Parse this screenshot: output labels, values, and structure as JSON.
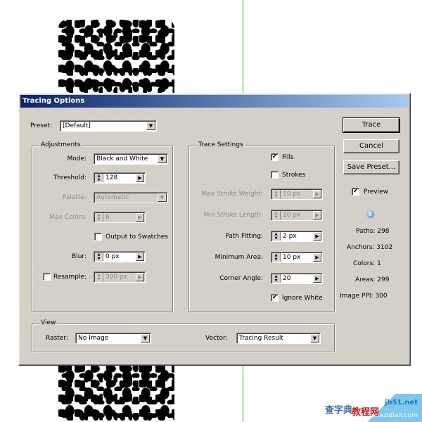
{
  "window": {
    "title": "Tracing Options"
  },
  "preset": {
    "label": "Preset:",
    "value": "[Default]"
  },
  "buttons": {
    "trace": "Trace",
    "cancel": "Cancel",
    "save_preset": "Save Preset..."
  },
  "preview": {
    "label": "Preview",
    "checked": true
  },
  "adjustments": {
    "title": "Adjustments",
    "mode_label": "Mode:",
    "mode_value": "Black and White",
    "threshold_label": "Threshold:",
    "threshold_value": "128",
    "palette_label": "Palette:",
    "palette_value": "Automatic",
    "max_colors_label": "Max Colors:",
    "max_colors_value": "6",
    "output_to_swatches_label": "Output to Swatches",
    "output_to_swatches_checked": false,
    "blur_label": "Blur:",
    "blur_value": "0 px",
    "resample_label": "Resample:",
    "resample_checked": false,
    "resample_value": "300 px"
  },
  "trace_settings": {
    "title": "Trace Settings",
    "fills_label": "Fills",
    "fills_checked": true,
    "strokes_label": "Strokes",
    "strokes_checked": false,
    "max_stroke_weight_label": "Max Stroke Weight:",
    "max_stroke_weight_value": "10 px",
    "min_stroke_length_label": "Min Stroke Length:",
    "min_stroke_length_value": "20 px",
    "path_fitting_label": "Path Fitting:",
    "path_fitting_value": "2 px",
    "minimum_area_label": "Minimum Area:",
    "minimum_area_value": "10 px",
    "corner_angle_label": "Corner Angle:",
    "corner_angle_value": "20",
    "ignore_white_label": "Ignore White",
    "ignore_white_checked": true
  },
  "view": {
    "title": "View",
    "raster_label": "Raster:",
    "raster_value": "No Image",
    "vector_label": "Vector:",
    "vector_value": "Tracing Result"
  },
  "stats": {
    "paths": "Paths: 298",
    "anchors": "Anchors: 3102",
    "colors": "Colors: 1",
    "areas": "Areas: 299",
    "image_ppi": "Image PPI: 300"
  },
  "watermark": {
    "line1": "jb51.net",
    "line2": "jiaocheng.chazidian.com",
    "cn1": "查字典",
    "cn2": "教程网"
  },
  "icons": {
    "checkmark": "✔",
    "dropdown": "▼",
    "spin_up": "▲",
    "spin_down": "▼",
    "spin_right": "▶",
    "info": "i"
  }
}
